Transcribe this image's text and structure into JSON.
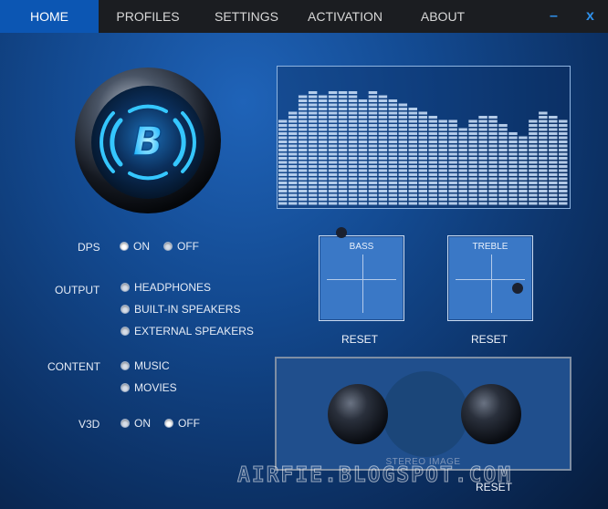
{
  "nav": {
    "tabs": [
      "HOME",
      "PROFILES",
      "SETTINGS",
      "ACTIVATION",
      "ABOUT"
    ],
    "active": "HOME",
    "minimize": "–",
    "close": "x"
  },
  "logo": {
    "icon": "b-logo-icon",
    "letter": "B"
  },
  "controls": {
    "dps": {
      "label": "DPS",
      "options": [
        "ON",
        "OFF"
      ],
      "selected": "ON"
    },
    "output": {
      "label": "OUTPUT",
      "options": [
        "HEADPHONES",
        "BUILT-IN SPEAKERS",
        "EXTERNAL SPEAKERS"
      ]
    },
    "content": {
      "label": "CONTENT",
      "options": [
        "MUSIC",
        "MOVIES"
      ]
    },
    "v3d": {
      "label": "V3D",
      "options": [
        "ON",
        "OFF"
      ],
      "selected": "OFF"
    }
  },
  "equalizer": {
    "levels": [
      0.62,
      0.7,
      0.82,
      0.86,
      0.83,
      0.84,
      0.85,
      0.84,
      0.8,
      0.84,
      0.83,
      0.78,
      0.74,
      0.72,
      0.7,
      0.66,
      0.62,
      0.62,
      0.58,
      0.62,
      0.66,
      0.66,
      0.6,
      0.54,
      0.52,
      0.62,
      0.68,
      0.65,
      0.62
    ]
  },
  "bass": {
    "title": "BASS",
    "reset": "RESET",
    "dot_x": 0.25,
    "dot_y": -0.04
  },
  "treble": {
    "title": "TREBLE",
    "reset": "RESET",
    "dot_x": 0.81,
    "dot_y": 0.61
  },
  "stereo_image": {
    "caption": "STEREO IMAGE",
    "reset": "RESET"
  },
  "watermark": "AIRFIE.BLOGSPOT.COM",
  "colors": {
    "accent": "#0c56b3",
    "nav_bg": "#1b1d21",
    "pad_bg": "#3a78c6",
    "eq_bar": "#c7dbf5"
  }
}
